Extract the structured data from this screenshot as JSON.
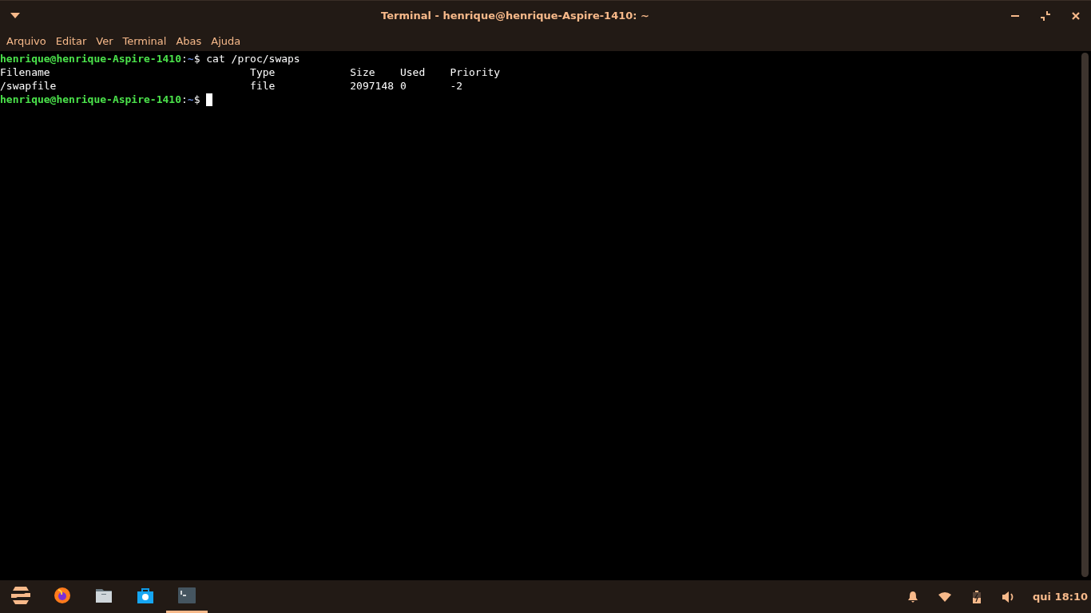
{
  "window": {
    "title": "Terminal - henrique@henrique-Aspire-1410: ~"
  },
  "menu": [
    "Arquivo",
    "Editar",
    "Ver",
    "Terminal",
    "Abas",
    "Ajuda"
  ],
  "terminal": {
    "lines": [
      [
        {
          "kind": "user",
          "text": "henrique@henrique-Aspire-1410"
        },
        {
          "kind": "plain",
          "text": ":"
        },
        {
          "kind": "path",
          "text": "~"
        },
        {
          "kind": "plain",
          "text": "$ cat /proc/swaps"
        }
      ],
      [
        {
          "kind": "plain",
          "text": "Filename                                Type            Size    Used    Priority"
        }
      ],
      [
        {
          "kind": "plain",
          "text": "/swapfile                               file            2097148 0       -2"
        }
      ],
      [
        {
          "kind": "user",
          "text": "henrique@henrique-Aspire-1410"
        },
        {
          "kind": "plain",
          "text": ":"
        },
        {
          "kind": "path",
          "text": "~"
        },
        {
          "kind": "plain",
          "text": "$ "
        },
        {
          "kind": "cursor"
        }
      ]
    ]
  },
  "taskbar": {
    "apps": [
      {
        "kind": "zorin",
        "selected": false
      },
      {
        "kind": "firefox",
        "selected": false
      },
      {
        "kind": "files",
        "selected": false
      },
      {
        "kind": "store",
        "selected": false
      },
      {
        "kind": "terminal",
        "selected": true
      }
    ],
    "clock": "qui 18:10"
  }
}
